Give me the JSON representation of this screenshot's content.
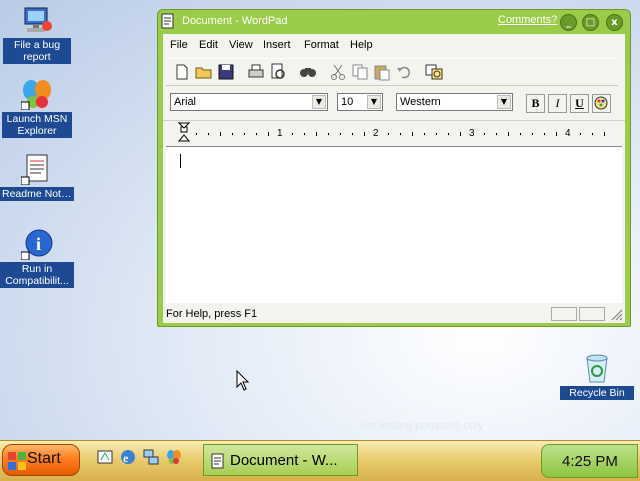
{
  "desktop": {
    "icons": [
      {
        "label": "File a bug report"
      },
      {
        "label": "Launch MSN Explorer"
      },
      {
        "label": "Readme Notes"
      },
      {
        "label": "Run in Compatibilit..."
      },
      {
        "label": "Recycle Bin"
      }
    ],
    "watermark": "For testing purposes only"
  },
  "window": {
    "title": "Document - WordPad",
    "comments_link": "Comments?",
    "buttons": {
      "minimize": "_",
      "maximize": "□",
      "close": "x"
    },
    "menu": [
      "File",
      "Edit",
      "View",
      "Insert",
      "Format",
      "Help"
    ],
    "format": {
      "font": "Arial",
      "size": "10",
      "script": "Western",
      "bold": "B",
      "italic": "I",
      "underline": "U"
    },
    "ruler": [
      "1",
      "2",
      "3",
      "4"
    ],
    "status": "For Help, press F1"
  },
  "taskbar": {
    "start_label": "Start",
    "task_label": "Document - W...",
    "clock": "4:25 PM"
  },
  "colors": {
    "window_frame": "#9acc4a",
    "taskbar": "#e7c96a",
    "start_button": "#ff7f1f",
    "icon_label_bg": "#1e4a93"
  }
}
